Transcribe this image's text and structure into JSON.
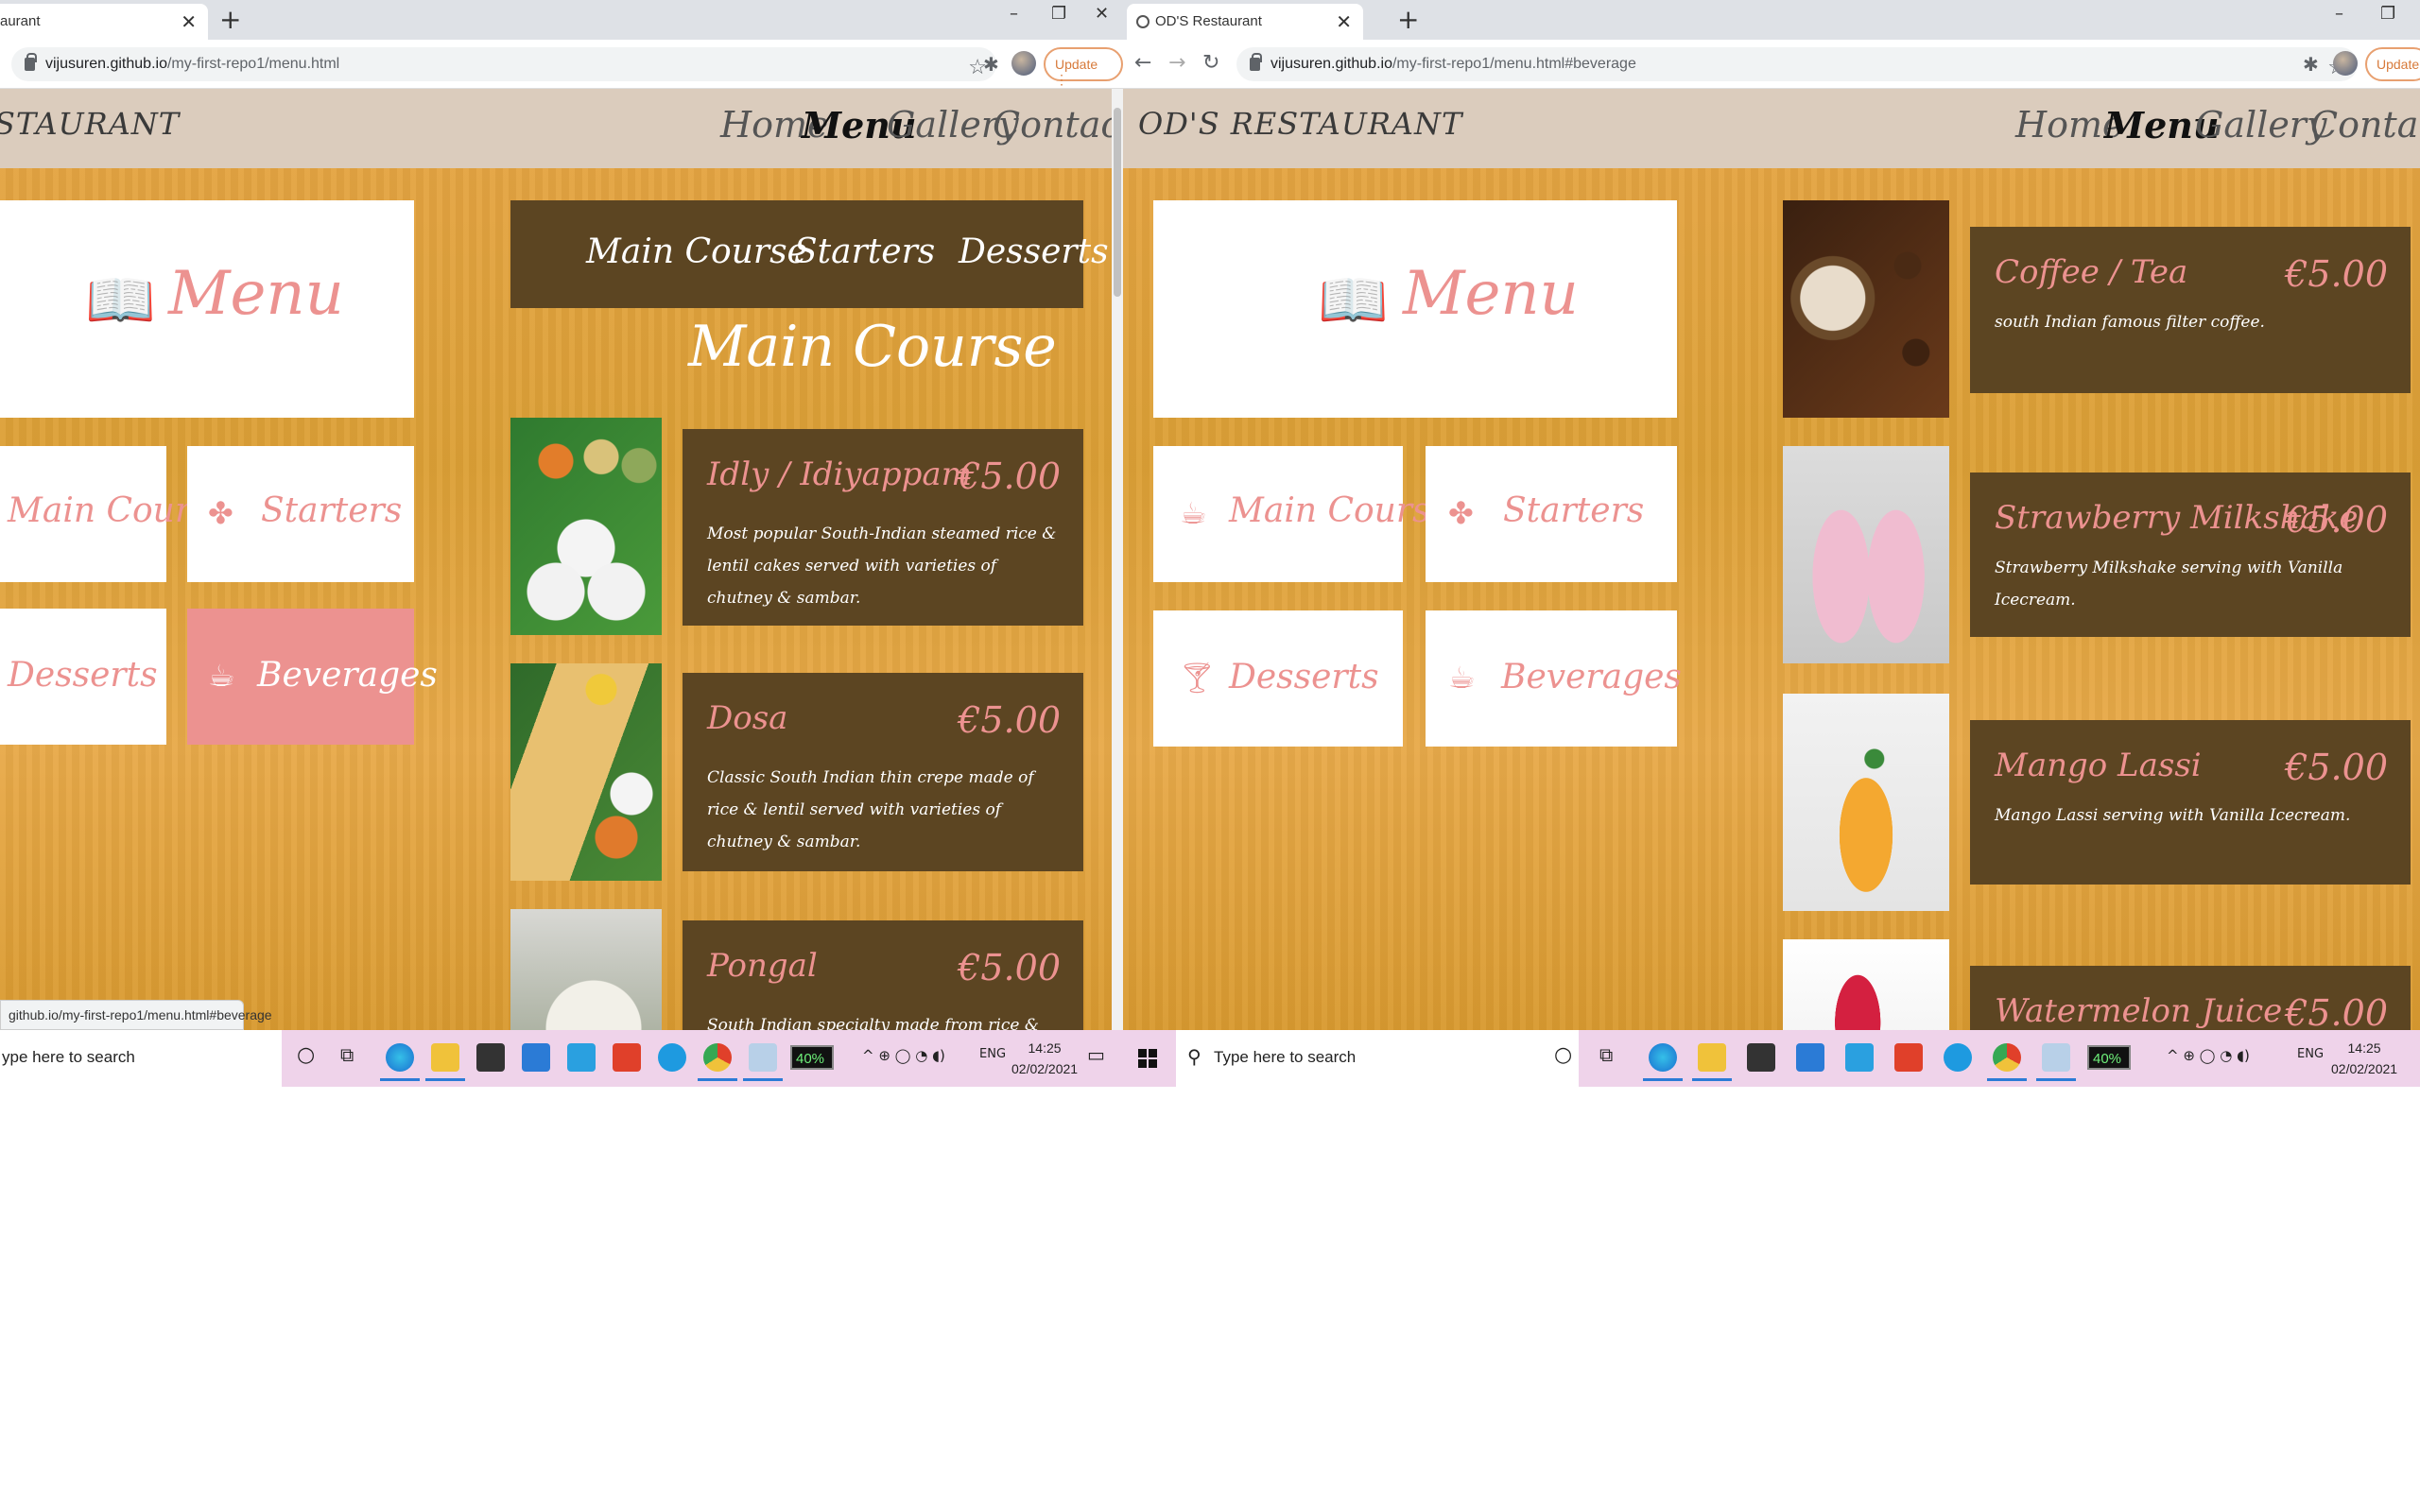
{
  "left": {
    "tab_title": "aurant",
    "url_host": "vijusuren.github.io",
    "url_path": "/my-first-repo1/menu.html",
    "update_label": "Update",
    "brand": "STAURANT",
    "nav": [
      "Home",
      "Menu",
      "Gallery",
      "Contact"
    ],
    "menu_title": "Menu",
    "categories": [
      "Main Course",
      "Starters",
      "Desserts",
      "Beverages"
    ],
    "tabbar": [
      "Main Course",
      "Starters",
      "Desserts"
    ],
    "section_title": "Main Course",
    "dishes": [
      {
        "name": "Idly / Idiyappam",
        "price": "€5.00",
        "desc": "Most popular South-Indian steamed rice & lentil cakes served with varieties of chutney & sambar."
      },
      {
        "name": "Dosa",
        "price": "€5.00",
        "desc": "Classic South Indian thin crepe made of rice & lentil served with varieties of chutney & sambar."
      },
      {
        "name": "Pongal",
        "price": "€5.00",
        "desc": "South Indian specialty made from rice & lentil cooked served"
      }
    ],
    "status_url": "github.io/my-first-repo1/menu.html#beverage",
    "search_placeholder": "ype here to search",
    "battery": "40%",
    "lang": "ENG",
    "time": "14:25",
    "date": "02/02/2021"
  },
  "right": {
    "tab_title": "OD'S Restaurant",
    "url_host": "vijusuren.github.io",
    "url_path": "/my-first-repo1/menu.html#beverage",
    "update_label": "Update",
    "brand": "OD'S RESTAURANT",
    "nav": [
      "Home",
      "Menu",
      "Gallery",
      "Contact"
    ],
    "menu_title": "Menu",
    "categories": [
      "Main Course",
      "Starters",
      "Desserts",
      "Beverages"
    ],
    "drinks": [
      {
        "name": "Coffee / Tea",
        "price": "€5.00",
        "desc": "south Indian famous filter coffee."
      },
      {
        "name": "Strawberry Milkshake",
        "price": "€5.00",
        "desc": "Strawberry Milkshake serving with Vanilla Icecream."
      },
      {
        "name": "Mango Lassi",
        "price": "€5.00",
        "desc": "Mango Lassi serving with Vanilla Icecream."
      },
      {
        "name": "Watermelon Juice",
        "price": "€5.00",
        "desc": ""
      }
    ],
    "search_placeholder": "Type here to search",
    "battery": "40%",
    "lang": "ENG",
    "time": "14:25",
    "date": "02/02/2021"
  },
  "colors": {
    "accent_pink": "#ec9290",
    "panel_brown": "#5c4522",
    "navbar_beige": "#dbccbd",
    "wood": "#e0a23c"
  },
  "icons": [
    "book-icon",
    "coffee-cup-icon",
    "users-icon",
    "cocktail-icon",
    "lock-icon",
    "star-icon",
    "puzzle-icon",
    "windows-logo-icon",
    "search-icon"
  ]
}
